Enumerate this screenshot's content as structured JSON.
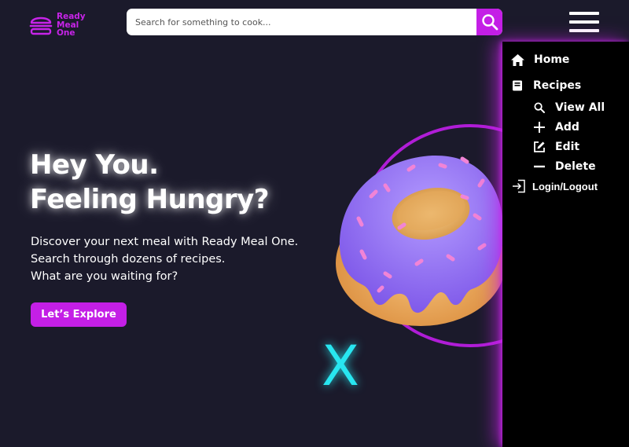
{
  "brand": {
    "logo_icon": "burger-icon",
    "name_lines": [
      "Ready",
      "Meal",
      "One"
    ],
    "color": "#c724e8"
  },
  "search": {
    "placeholder": "Search for something to cook...",
    "value": "",
    "button_icon": "search-icon"
  },
  "header": {
    "menu_icon": "hamburger-icon"
  },
  "hero": {
    "title_lines": [
      "Hey You.",
      "Feeling Hungry?"
    ],
    "description_lines": [
      "Discover your next meal with Ready Meal One.",
      "Search through dozens of recipes.",
      "What are you waiting for?"
    ],
    "cta_label": "Let’s Explore",
    "close_glyph": "X"
  },
  "menu": {
    "items": [
      {
        "label": "Home",
        "icon": "home-icon"
      },
      {
        "label": "Recipes",
        "icon": "book-icon"
      },
      {
        "label": "View All",
        "icon": "search-icon"
      },
      {
        "label": "Add",
        "icon": "plus-icon"
      },
      {
        "label": "Edit",
        "icon": "edit-icon"
      },
      {
        "label": "Delete",
        "icon": "minus-icon"
      },
      {
        "label": "Login/Logout",
        "icon": "login-icon"
      }
    ]
  },
  "colors": {
    "background": "#1b1a2b",
    "accent": "#c41fe6",
    "menu_background": "#000000",
    "x_glow": "#28e6f0"
  }
}
